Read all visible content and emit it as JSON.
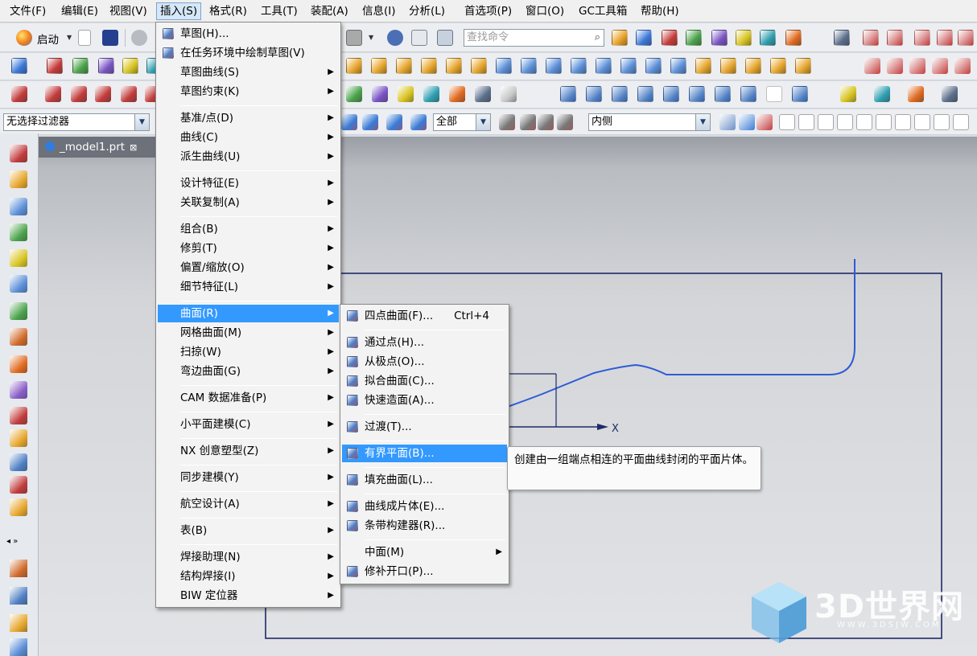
{
  "menubar": {
    "items": [
      "文件(F)",
      "编辑(E)",
      "视图(V)",
      "插入(S)",
      "格式(R)",
      "工具(T)",
      "装配(A)",
      "信息(I)",
      "分析(L)",
      "首选项(P)",
      "窗口(O)",
      "GC工具箱",
      "帮助(H)"
    ],
    "active_index": 3
  },
  "toolbar": {
    "start_label": "启动",
    "search_placeholder": "查找命令",
    "filter_value": "无选择过滤器",
    "scope_value": "全部",
    "inside_value": "内侧"
  },
  "document": {
    "tab_title": "_model1.prt"
  },
  "axis_label": "X",
  "insert_menu": [
    {
      "label": "草图(H)...",
      "icon": "sketch-icon",
      "submenu": false
    },
    {
      "label": "在任务环境中绘制草图(V)",
      "icon": "sketch-task-icon",
      "submenu": false
    },
    {
      "label": "草图曲线(S)",
      "submenu": true
    },
    {
      "label": "草图约束(K)",
      "submenu": true
    },
    {
      "separator": true
    },
    {
      "label": "基准/点(D)",
      "submenu": true
    },
    {
      "label": "曲线(C)",
      "submenu": true
    },
    {
      "label": "派生曲线(U)",
      "submenu": true
    },
    {
      "separator": true
    },
    {
      "label": "设计特征(E)",
      "submenu": true
    },
    {
      "label": "关联复制(A)",
      "submenu": true
    },
    {
      "separator": true
    },
    {
      "label": "组合(B)",
      "submenu": true
    },
    {
      "label": "修剪(T)",
      "submenu": true
    },
    {
      "label": "偏置/缩放(O)",
      "submenu": true
    },
    {
      "label": "细节特征(L)",
      "submenu": true
    },
    {
      "separator": true
    },
    {
      "label": "曲面(R)",
      "submenu": true,
      "highlighted": true
    },
    {
      "label": "网格曲面(M)",
      "submenu": true
    },
    {
      "label": "扫掠(W)",
      "submenu": true
    },
    {
      "label": "弯边曲面(G)",
      "submenu": true
    },
    {
      "separator": true
    },
    {
      "label": "CAM 数据准备(P)",
      "submenu": true
    },
    {
      "separator": true
    },
    {
      "label": "小平面建模(C)",
      "submenu": true
    },
    {
      "separator": true
    },
    {
      "label": "NX 创意塑型(Z)",
      "submenu": true
    },
    {
      "separator": true
    },
    {
      "label": "同步建模(Y)",
      "submenu": true
    },
    {
      "separator": true
    },
    {
      "label": "航空设计(A)",
      "submenu": true
    },
    {
      "separator": true
    },
    {
      "label": "表(B)",
      "submenu": true
    },
    {
      "separator": true
    },
    {
      "label": "焊接助理(N)",
      "submenu": true
    },
    {
      "label": "结构焊接(I)",
      "submenu": true
    },
    {
      "label": "BIW 定位器",
      "submenu": true
    }
  ],
  "surface_menu": [
    {
      "label": "四点曲面(F)...",
      "shortcut": "Ctrl+4",
      "icon": "four-point-surface-icon"
    },
    {
      "separator": true
    },
    {
      "label": "通过点(H)...",
      "icon": "through-points-icon"
    },
    {
      "label": "从极点(O)...",
      "icon": "from-poles-icon"
    },
    {
      "label": "拟合曲面(C)...",
      "icon": "fit-surface-icon"
    },
    {
      "label": "快速造面(A)...",
      "icon": "rapid-surfacing-icon"
    },
    {
      "separator": true
    },
    {
      "label": "过渡(T)...",
      "icon": "transition-icon"
    },
    {
      "separator": true
    },
    {
      "label": "有界平面(B)...",
      "icon": "bounded-plane-icon",
      "highlighted": true
    },
    {
      "separator": true
    },
    {
      "label": "填充曲面(L)...",
      "icon": "fill-surface-icon"
    },
    {
      "separator": true
    },
    {
      "label": "曲线成片体(E)...",
      "icon": "curve-to-sheet-icon"
    },
    {
      "label": "条带构建器(R)...",
      "icon": "ribbon-builder-icon"
    },
    {
      "separator": true
    },
    {
      "label": "中面(M)",
      "submenu": true
    },
    {
      "label": "修补开口(P)...",
      "icon": "patch-openings-icon"
    }
  ],
  "tooltip": {
    "text": "创建由一组端点相连的平面曲线封闭的平面片体。"
  },
  "watermark": {
    "brand": "3D世界网",
    "url": "WWW.3DSJW.COM"
  },
  "colors": {
    "menu_highlight": "#3399ff",
    "curve": "#2e5bd6",
    "frame": "#1f2a66"
  }
}
